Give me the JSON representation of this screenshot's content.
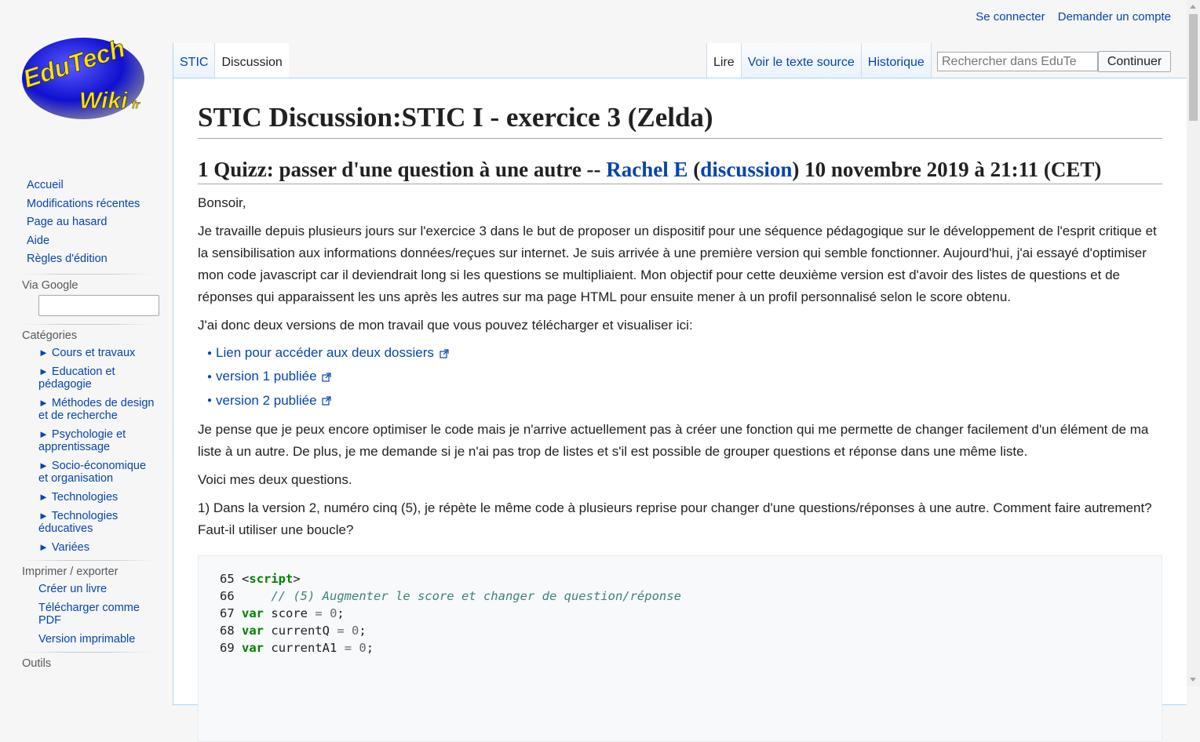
{
  "logo": {
    "line1": "EduTech",
    "line2": "Wiki",
    "suffix": "fr"
  },
  "personal_tools": {
    "login": "Se connecter",
    "create_account": "Demander un compte"
  },
  "tabs_left": [
    "STIC",
    "Discussion"
  ],
  "tabs_right": [
    "Lire",
    "Voir le texte source",
    "Historique"
  ],
  "search": {
    "placeholder": "Rechercher dans EduTe",
    "button": "Continuer"
  },
  "sidebar": {
    "nav": [
      "Accueil",
      "Modifications récentes",
      "Page au hasard",
      "Aide",
      "Règles d'édition"
    ],
    "google_label": "Via Google",
    "categories_label": "Catégories",
    "categories": [
      "Cours et travaux",
      "Education et pédagogie",
      "Méthodes de design et de recherche",
      "Psychologie et apprentissage",
      "Socio-économique et organisation",
      "Technologies",
      "Technologies éducatives",
      "Variées"
    ],
    "print_label": "Imprimer / exporter",
    "print_items": [
      "Créer un livre",
      "Télécharger comme PDF",
      "Version imprimable"
    ],
    "tools_label": "Outils"
  },
  "content": {
    "title": "STIC Discussion:STIC I - exercice 3 (Zelda)",
    "section": {
      "prefix": "1 Quizz: passer d'une question à une autre -- ",
      "user": "Rachel E",
      "open_paren": " (",
      "talk": "discussion",
      "suffix": ") 10 novembre 2019 à 21:11 (CET)"
    },
    "p1": "Bonsoir,",
    "p2": "Je travaille depuis plusieurs jours sur l'exercice 3 dans le but de proposer un dispositif pour une séquence pédagogique sur le développement de l'esprit critique et la sensibilisation aux informations données/reçues sur internet. Je suis arrivée à une première version qui semble fonctionner. Aujourd'hui, j'ai essayé d'optimiser mon code javascript car il deviendrait long si les questions se multipliaient. Mon objectif pour cette deuxième version est d'avoir des listes de questions et de réponses qui apparaissent les uns après les autres sur ma page HTML pour ensuite mener à un profil personnalisé selon le score obtenu.",
    "p3": "J'ai donc deux versions de mon travail que vous pouvez télécharger et visualiser ici:",
    "links": [
      "Lien pour accéder aux deux dossiers",
      "version 1 publiée",
      "version 2 publiée"
    ],
    "p4": "Je pense que je peux encore optimiser le code mais je n'arrive actuellement pas à créer une fonction qui me permette de changer facilement d'un élément de ma liste à un autre. De plus, je me demande si je n'ai pas trop de listes et s'il est possible de grouper questions et réponse dans une même liste.",
    "p5": "Voici mes deux questions.",
    "p6": "1) Dans la version 2, numéro cinq (5), je répète le même code à plusieurs reprise pour changer d'une questions/réponses à une autre. Comment faire autrement? Faut-il utiliser une boucle?",
    "code": {
      "l65_num": "65",
      "l65_open": "<",
      "l65_tag": "script",
      "l65_close": ">",
      "l66_num": "66",
      "l66_comment": "// (5) Augmenter le score et changer de question/réponse",
      "l67_num": "67",
      "l67_var": "score",
      "l68_num": "68",
      "l68_var": "currentQ",
      "l69_num": "69",
      "l69_var": "currentA1",
      "kw": "var",
      "eq": "=",
      "zero": "0",
      "semi": ";"
    }
  }
}
